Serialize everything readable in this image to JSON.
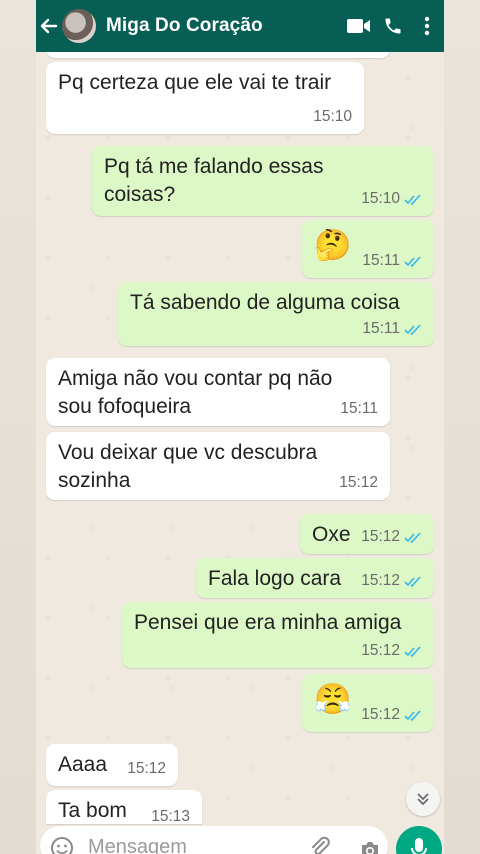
{
  "header": {
    "contact_name": "Miga Do Coração",
    "icons": [
      "back-arrow-icon",
      "video-call-icon",
      "phone-icon",
      "more-options-icon"
    ]
  },
  "messages": [
    {
      "dir": "in",
      "text": "Pq certeza que ele vai te trair",
      "time": "15:10",
      "read": false
    },
    {
      "dir": "out",
      "text": "Pq tá me falando essas\ncoisas?",
      "time": "15:10",
      "read": true
    },
    {
      "dir": "out",
      "text": "🤔",
      "time": "15:11",
      "read": true
    },
    {
      "dir": "out",
      "text": "Tá sabendo de alguma coisa",
      "time": "15:11",
      "read": true
    },
    {
      "dir": "in",
      "text": "Amiga não vou contar pq não\nsou fofoqueira",
      "time": "15:11",
      "read": false
    },
    {
      "dir": "in",
      "text": "Vou deixar que vc descubra\nsozinha",
      "time": "15:12",
      "read": false
    },
    {
      "dir": "out",
      "text": "Oxe",
      "time": "15:12",
      "read": true
    },
    {
      "dir": "out",
      "text": "Fala logo cara",
      "time": "15:12",
      "read": true
    },
    {
      "dir": "out",
      "text": "Pensei que era minha amiga",
      "time": "15:12",
      "read": true
    },
    {
      "dir": "out",
      "text": "😤",
      "time": "15:12",
      "read": true
    },
    {
      "dir": "in",
      "text": "Aaaa",
      "time": "15:12",
      "read": false
    },
    {
      "dir": "in",
      "text": "Ta bom",
      "time": "15:13",
      "read": false
    }
  ],
  "partial_top_time": "15:10",
  "composer": {
    "placeholder": "Mensagem",
    "icons": [
      "emoji-icon",
      "attach-icon",
      "camera-icon",
      "mic-icon"
    ]
  },
  "colors": {
    "header": "#075e54",
    "outgoing_bubble": "#dcf8c6",
    "incoming_bubble": "#ffffff",
    "read_ticks": "#34b7f1",
    "mic_button": "#00a884"
  }
}
